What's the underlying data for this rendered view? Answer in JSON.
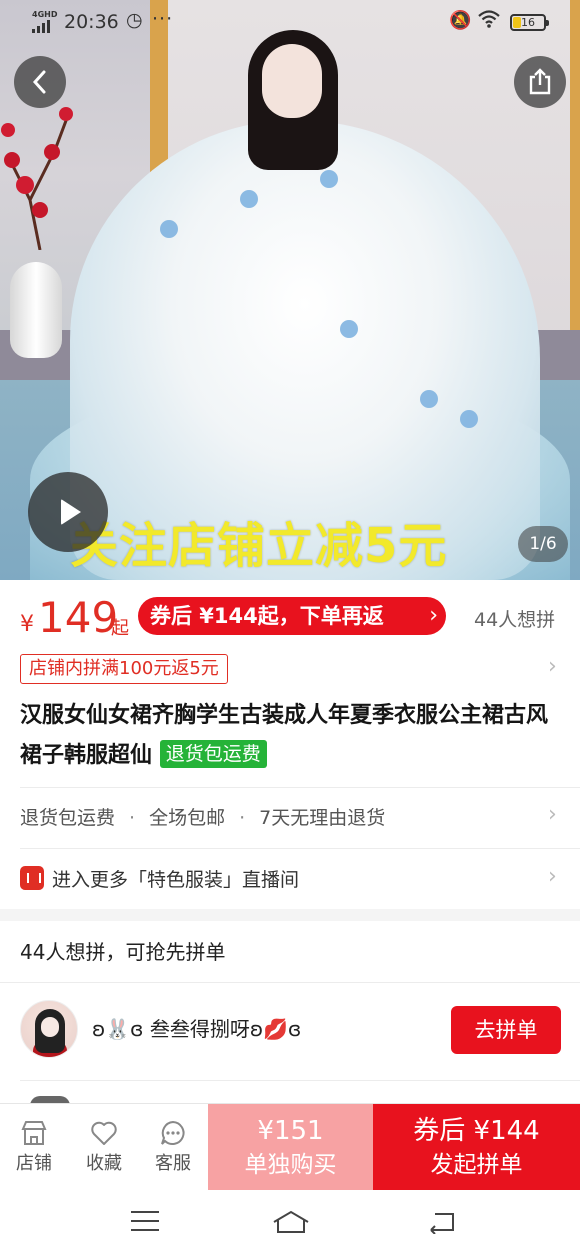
{
  "status_bar": {
    "network": "4GHD",
    "time": "20:36",
    "battery": "16",
    "icons": [
      "signal-icon",
      "dnd-icon",
      "more-dots-icon",
      "mute-icon",
      "wifi-icon",
      "battery-icon"
    ]
  },
  "hero": {
    "overlay_text": "关注店铺立减5元",
    "pager": "1/6",
    "icons": [
      "back-arrow-icon",
      "share-icon",
      "play-icon"
    ]
  },
  "price": {
    "currency": "¥",
    "value": "149",
    "suffix": "起",
    "coupon_text": "券后 ¥144起，下单再返",
    "coupon_chevron": "›",
    "want_count": "44人想拼"
  },
  "promo": {
    "tag": "店铺内拼满100元返5元"
  },
  "product": {
    "title": "汉服女仙女裙齐胸学生古装成人年夏季衣服公主裙古风裙子韩服超仙",
    "badge": "退货包运费"
  },
  "services": {
    "items": [
      "退货包运费",
      "全场包邮",
      "7天无理由退货"
    ],
    "separator": "·"
  },
  "live": {
    "text": "进入更多「特色服装」直播间"
  },
  "group": {
    "heading": "44人想拼，可抢先拼单",
    "rows": [
      {
        "nickname": "ʚ🐰ɞ 叁叁得捌呀ʚ💋ɞ",
        "button": "去拼单"
      }
    ]
  },
  "action_bar": {
    "tools": [
      {
        "label": "店铺",
        "icon": "store-icon"
      },
      {
        "label": "收藏",
        "icon": "heart-icon"
      },
      {
        "label": "客服",
        "icon": "chat-icon"
      }
    ],
    "solo": {
      "price": "¥151",
      "label": "单独购买"
    },
    "group_buy": {
      "price": "券后 ¥144",
      "label": "发起拼单"
    }
  },
  "colors": {
    "brand_red": "#e8121e",
    "price_red": "#e02e24",
    "solo_pink": "#f7a2a3",
    "badge_green": "#25b338",
    "overlay_yellow": "#f2e92b"
  }
}
